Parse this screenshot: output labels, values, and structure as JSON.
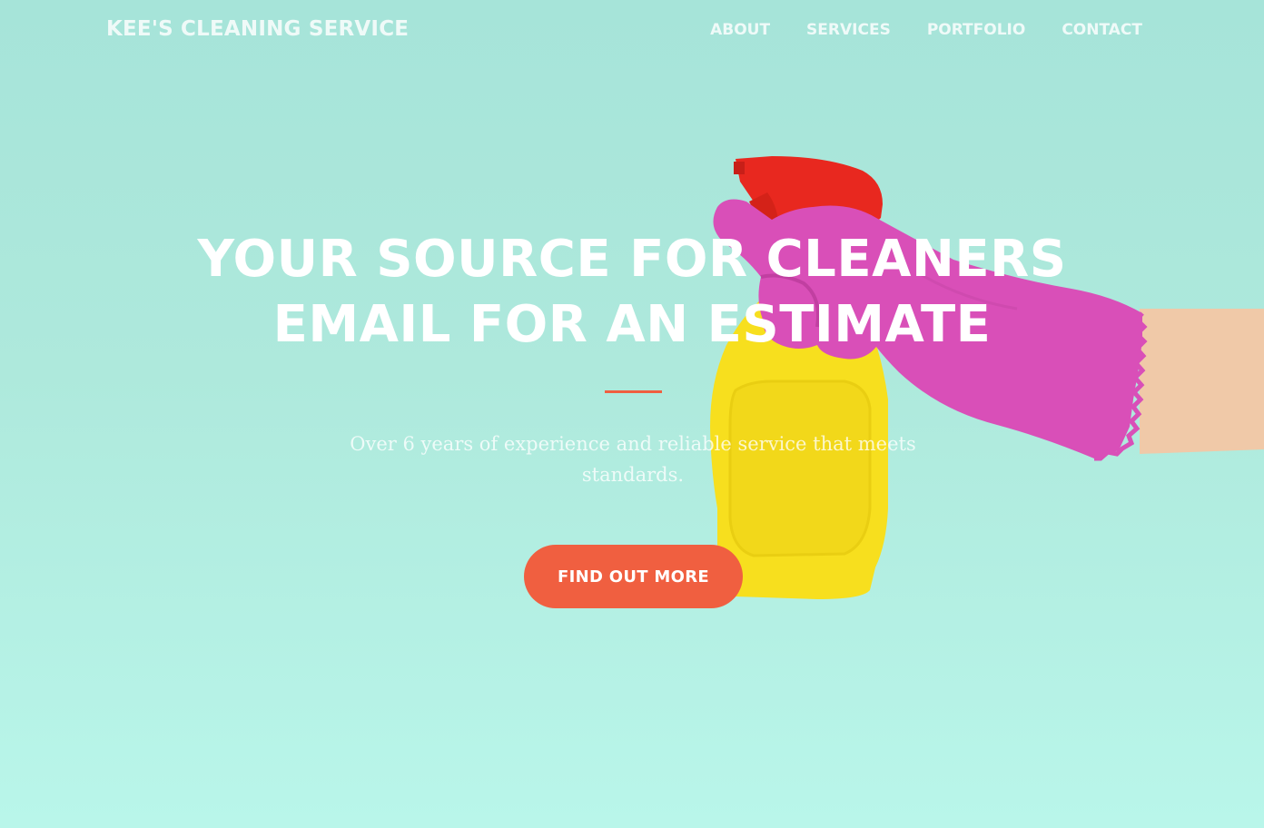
{
  "navbar": {
    "brand": "KEE'S CLEANING SERVICE",
    "links": [
      "ABOUT",
      "SERVICES",
      "PORTFOLIO",
      "CONTACT"
    ]
  },
  "hero": {
    "title_line1": "YOUR SOURCE FOR CLEANERS",
    "title_line2": "EMAIL FOR AN ESTIMATE",
    "subtitle": "Over 6 years of experience and reliable service that meets standards.",
    "cta_label": "FIND OUT MORE"
  },
  "colors": {
    "accent": "#f05f40",
    "background": "#aee9dc",
    "glove": "#d94fb8",
    "bottle": "#f7df1e",
    "trigger": "#e8281f"
  },
  "icons": [
    "spray-bottle-in-gloved-hand-image"
  ]
}
